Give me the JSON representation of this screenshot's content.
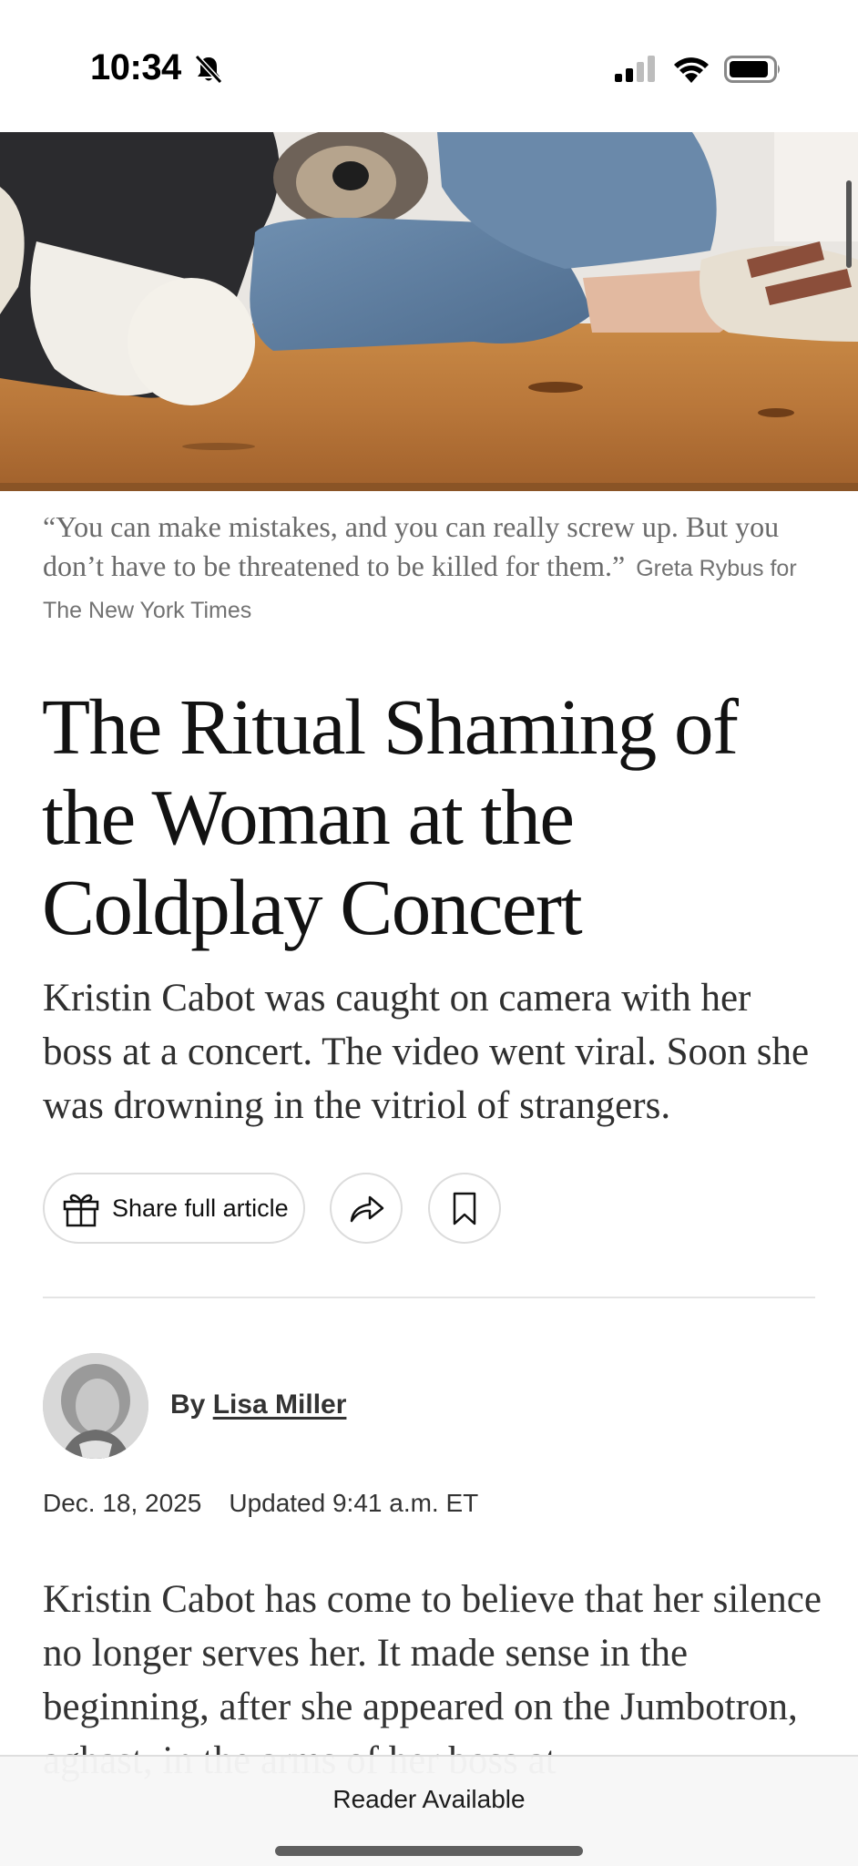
{
  "status_bar": {
    "time": "10:34",
    "icons": [
      "bell-slash-icon",
      "cellular-signal-icon",
      "wifi-icon",
      "battery-icon"
    ]
  },
  "hero": {
    "image": "photo-dog-and-person-on-wooden-floor"
  },
  "caption": {
    "quote": "“You can make mistakes, and you can really screw up. But you don’t have to be threatened to be killed for them.”",
    "credit": "Greta Rybus for The New York Times"
  },
  "article": {
    "headline": "The Ritual Shaming of the Woman at the Coldplay Concert",
    "summary": "Kristin Cabot was caught on camera with her boss at a concert. The video went viral. Soon she was drowning in the vitriol of strangers.",
    "byline_prefix": "By ",
    "author": "Lisa Miller",
    "date": "Dec. 18, 2025",
    "updated": "Updated 9:41 a.m. ET",
    "body": "Kristin Cabot has come to believe that her silence no longer serves her. It made sense in the beginning, after she appeared on the Jumbotron, aghast, in the arms of her boss at"
  },
  "actions": {
    "share_full_label": "Share full article",
    "icons": [
      "gift-icon",
      "share-arrow-icon",
      "bookmark-icon"
    ]
  },
  "bottom_bar": {
    "reader_label": "Reader Available"
  },
  "colors": {
    "text": "#121212",
    "caption": "#6a6a6a",
    "border": "#dcdcdc"
  }
}
